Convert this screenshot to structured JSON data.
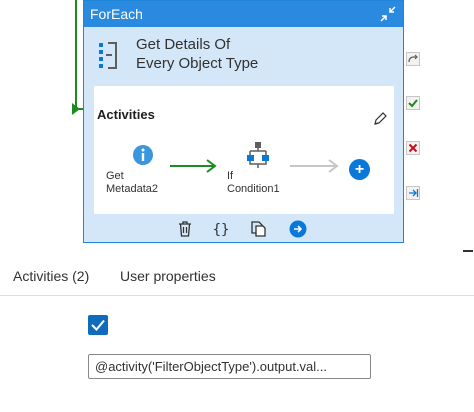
{
  "foreach": {
    "header": "ForEach",
    "activity_title": "Get Details Of\nEvery Object Type",
    "inner_title": "Activities",
    "activities": [
      {
        "label": "Get\nMetadata2",
        "icon": "info-icon"
      },
      {
        "label": "If\nCondition1",
        "icon": "if-condition-icon"
      }
    ],
    "add_label": "+",
    "toolbar_icons": [
      "delete-icon",
      "code-icon",
      "copy-icon",
      "go-icon"
    ]
  },
  "side_icons": [
    "redo-icon",
    "success-check-icon",
    "failure-x-icon",
    "completion-arrow-icon"
  ],
  "tabs": [
    {
      "label": "Activities (2)"
    },
    {
      "label": "User properties"
    }
  ],
  "settings": {
    "checkbox_checked": true,
    "items_expression": "@activity('FilterObjectType').output.val..."
  },
  "colors": {
    "header": "#2a8ae0",
    "container": "#d3e7f8",
    "accent": "#0a78d7",
    "success": "#1e8b22",
    "failure": "#c50f1f"
  }
}
